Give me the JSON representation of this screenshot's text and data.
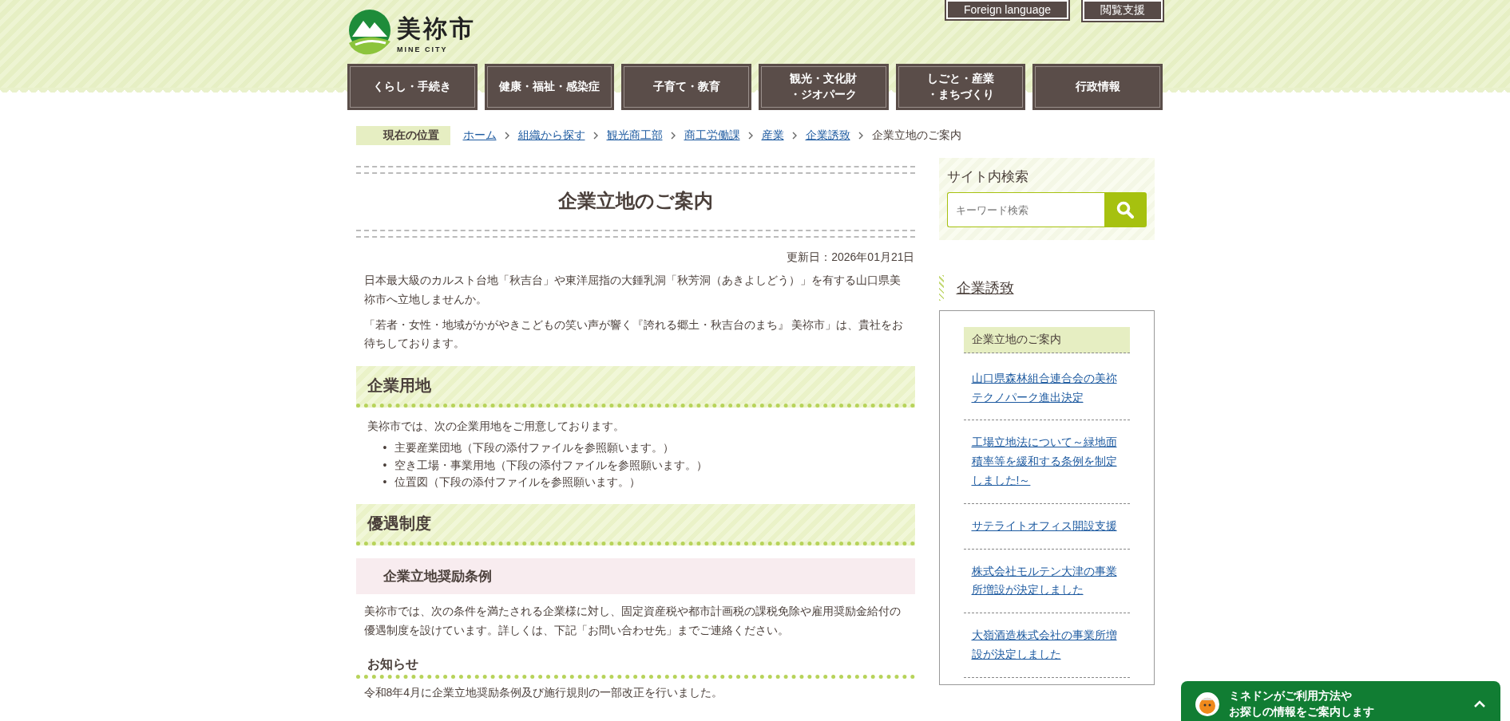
{
  "header": {
    "logo": {
      "name": "美祢市",
      "subtitle": "MINE CITY"
    },
    "utility_links": [
      "Foreign language",
      "閲覧支援"
    ],
    "nav": [
      [
        "くらし・手続き"
      ],
      [
        "健康・福祉・感染症"
      ],
      [
        "子育て・教育"
      ],
      [
        "観光・文化財",
        "・ジオパーク"
      ],
      [
        "しごと・産業",
        "・まちづくり"
      ],
      [
        "行政情報"
      ]
    ]
  },
  "breadcrumb": {
    "label": "現在の位置",
    "items": [
      {
        "text": "ホーム",
        "kind": "link"
      },
      {
        "text": "組織から探す",
        "kind": "link"
      },
      {
        "text": "観光商工部",
        "kind": "link"
      },
      {
        "text": "商工労働課",
        "kind": "link"
      },
      {
        "text": "産業",
        "kind": "link"
      },
      {
        "text": "企業誘致",
        "kind": "link"
      },
      {
        "text": "企業立地のご案内",
        "kind": "current"
      }
    ]
  },
  "article": {
    "title": "企業立地のご案内",
    "updated": "更新日：2026年01月21日",
    "blocks": [
      {
        "kind": "paragraph",
        "text": "日本最大級のカルスト台地「秋吉台」や東洋屈指の大鍾乳洞「秋芳洞（あきよしどう）」を有する山口県美祢市へ立地しませんか。"
      },
      {
        "kind": "paragraph",
        "text": "「若者・女性・地域がかがやきこどもの笑い声が響く『誇れる郷土・秋吉台のまち』 美祢市」は、貴社をお待ちしております。"
      },
      {
        "kind": "heading2",
        "text": "企業用地"
      },
      {
        "kind": "lead",
        "text": "美祢市では、次の企業用地をご用意しております。"
      },
      {
        "kind": "list",
        "bullet": "•",
        "items": [
          "主要産業団地（下段の添付ファイルを参照願います。）",
          "空き工場・事業用地（下段の添付ファイルを参照願います。）",
          "位置図（下段の添付ファイルを参照願います。）"
        ]
      },
      {
        "kind": "heading2",
        "text": "優遇制度"
      },
      {
        "kind": "heading3",
        "text": "企業立地奨励条例"
      },
      {
        "kind": "paragraph",
        "text": "美祢市では、次の条件を満たされる企業様に対し、固定資産税や都市計画税の課税免除や雇用奨励金給付の優遇制度を設けています。詳しくは、下記「お問い合わせ先」までご連絡ください。"
      },
      {
        "kind": "heading4",
        "text": "お知らせ"
      },
      {
        "kind": "paragraph",
        "text": "令和8年4月に企業立地奨励条例及び施行規則の一部改正を行いました。"
      }
    ]
  },
  "sidebar": {
    "search": {
      "title": "サイト内検索",
      "placeholder": "キーワード検索"
    },
    "category": {
      "title": "企業誘致",
      "items": [
        {
          "text": "企業立地のご案内",
          "selected": true
        },
        {
          "text": "山口県森林組合連合会の美祢テクノパーク進出決定",
          "selected": false
        },
        {
          "text": "工場立地法について～緑地面積率等を緩和する条例を制定しました!～",
          "selected": false
        },
        {
          "text": "サテライトオフィス開設支援",
          "selected": false
        },
        {
          "text": "株式会社モルテン大津の事業所増設が決定しました",
          "selected": false
        },
        {
          "text": "大嶺酒造株式会社の事業所増設が決定しました",
          "selected": false
        }
      ]
    }
  },
  "assistant_bar": {
    "lines": [
      "ミネドンがご利用方法や",
      "お探しの情報をご案内します"
    ]
  }
}
